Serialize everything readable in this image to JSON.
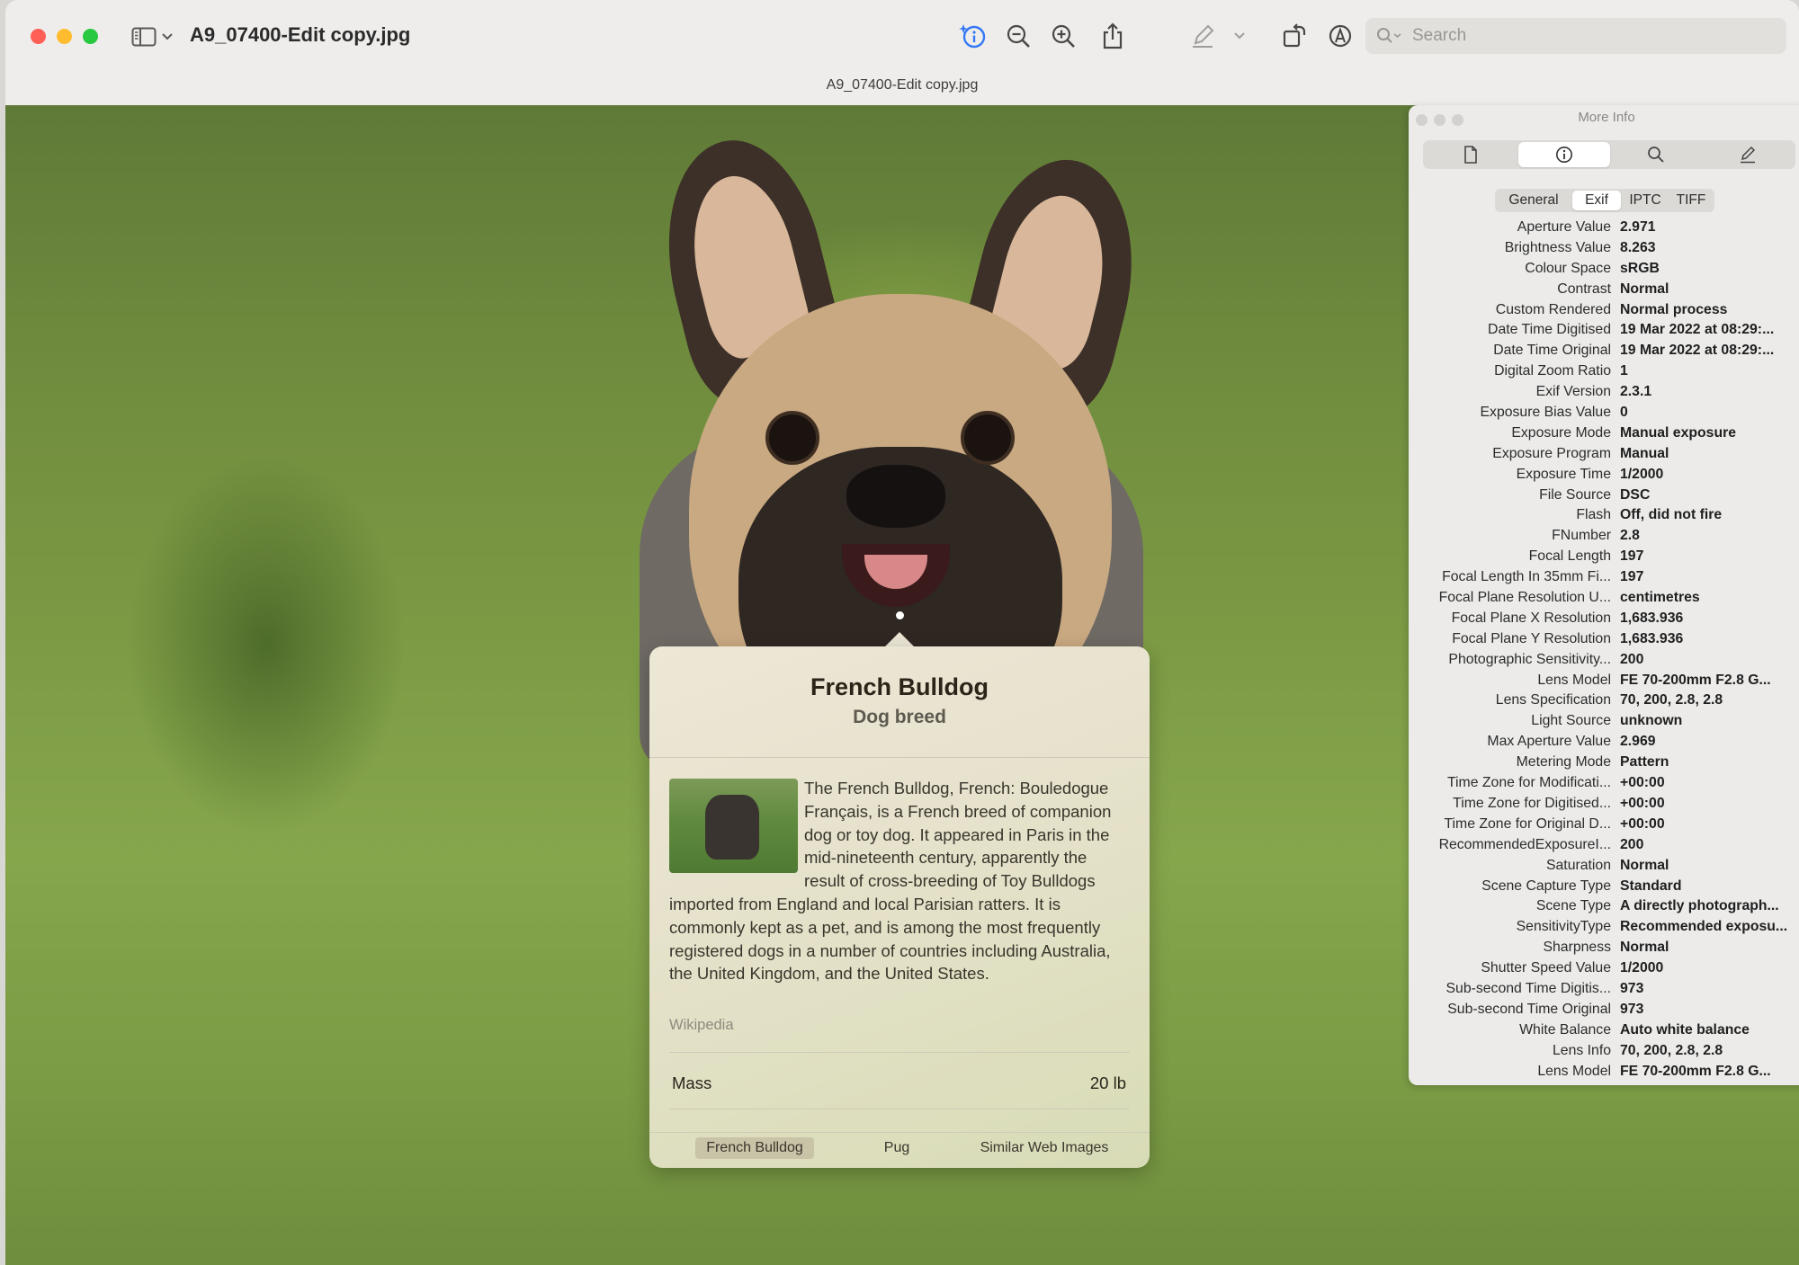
{
  "window": {
    "title": "A9_07400-Edit copy.jpg",
    "subtitle": "A9_07400-Edit copy.jpg",
    "search_placeholder": "Search"
  },
  "popover": {
    "title": "French Bulldog",
    "subtitle": "Dog breed",
    "description": "The French Bulldog, French: Bouledogue Français, is a French breed of companion dog or toy dog. It appeared in Paris in the mid-nineteenth century, apparently the result of cross-breeding of Toy Bulldogs imported from England and local Parisian ratters. It is commonly kept as a pet, and is among the most frequently registered dogs in a number of countries including Australia, the United Kingdom, and the United States.",
    "source": "Wikipedia",
    "mass_label": "Mass",
    "mass_value": "20 lb",
    "tabs": [
      "French Bulldog",
      "Pug",
      "Similar Web Images"
    ]
  },
  "info_panel": {
    "title": "More Info",
    "tabs": [
      "General",
      "Exif",
      "IPTC",
      "TIFF"
    ],
    "rows": [
      {
        "k": "Aperture Value",
        "v": "2.971"
      },
      {
        "k": "Brightness Value",
        "v": "8.263"
      },
      {
        "k": "Colour Space",
        "v": "sRGB"
      },
      {
        "k": "Contrast",
        "v": "Normal"
      },
      {
        "k": "Custom Rendered",
        "v": "Normal process"
      },
      {
        "k": "Date Time Digitised",
        "v": "19 Mar 2022 at 08:29:..."
      },
      {
        "k": "Date Time Original",
        "v": "19 Mar 2022 at 08:29:..."
      },
      {
        "k": "Digital Zoom Ratio",
        "v": "1"
      },
      {
        "k": "Exif Version",
        "v": "2.3.1"
      },
      {
        "k": "Exposure Bias Value",
        "v": "0"
      },
      {
        "k": "Exposure Mode",
        "v": "Manual exposure"
      },
      {
        "k": "Exposure Program",
        "v": "Manual"
      },
      {
        "k": "Exposure Time",
        "v": "1/2000"
      },
      {
        "k": "File Source",
        "v": "DSC"
      },
      {
        "k": "Flash",
        "v": "Off, did not fire"
      },
      {
        "k": "FNumber",
        "v": "2.8"
      },
      {
        "k": "Focal Length",
        "v": "197"
      },
      {
        "k": "Focal Length In 35mm Fi...",
        "v": "197"
      },
      {
        "k": "Focal Plane Resolution U...",
        "v": "centimetres"
      },
      {
        "k": "Focal Plane X Resolution",
        "v": "1,683.936"
      },
      {
        "k": "Focal Plane Y Resolution",
        "v": "1,683.936"
      },
      {
        "k": "Photographic Sensitivity...",
        "v": "200"
      },
      {
        "k": "Lens Model",
        "v": "FE 70-200mm F2.8 G..."
      },
      {
        "k": "Lens Specification",
        "v": "70, 200, 2.8, 2.8"
      },
      {
        "k": "Light Source",
        "v": "unknown"
      },
      {
        "k": "Max Aperture Value",
        "v": "2.969"
      },
      {
        "k": "Metering Mode",
        "v": "Pattern"
      },
      {
        "k": "Time Zone for Modificati...",
        "v": "+00:00"
      },
      {
        "k": "Time Zone for Digitised...",
        "v": "+00:00"
      },
      {
        "k": "Time Zone for Original D...",
        "v": "+00:00"
      },
      {
        "k": "RecommendedExposureI...",
        "v": "200"
      },
      {
        "k": "Saturation",
        "v": "Normal"
      },
      {
        "k": "Scene Capture Type",
        "v": "Standard"
      },
      {
        "k": "Scene Type",
        "v": "A directly photograph..."
      },
      {
        "k": "SensitivityType",
        "v": "Recommended exposu..."
      },
      {
        "k": "Sharpness",
        "v": "Normal"
      },
      {
        "k": "Shutter Speed Value",
        "v": "1/2000"
      },
      {
        "k": "Sub-second Time Digitis...",
        "v": "973"
      },
      {
        "k": "Sub-second Time Original",
        "v": "973"
      },
      {
        "k": "White Balance",
        "v": "Auto white balance"
      },
      {
        "k": "Lens Info",
        "v": "70, 200, 2.8, 2.8"
      },
      {
        "k": "Lens Model",
        "v": "FE 70-200mm F2.8 G..."
      }
    ]
  },
  "icons": {
    "toolbar": [
      "sidebar-icon",
      "chevron-down-icon",
      "visual-lookup-info-icon",
      "zoom-out-icon",
      "zoom-in-icon",
      "share-icon",
      "markup-pen-icon",
      "chevron-down-icon",
      "rotate-icon",
      "annotate-icon",
      "search-icon"
    ],
    "info_panel": [
      "document-icon",
      "info-icon",
      "search-icon",
      "pencil-icon"
    ]
  },
  "colors": {
    "close": "#ff5f57",
    "minimize": "#febc2e",
    "maximize": "#28c840",
    "accent": "#3478f6"
  }
}
